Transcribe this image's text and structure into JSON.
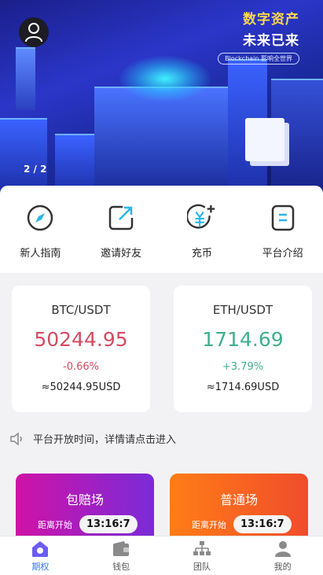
{
  "colors": {
    "accent": "#2d77ff",
    "down": "#d64a63",
    "up": "#3fae8d"
  },
  "banner": {
    "title_line1": "数字资产",
    "title_line2": "未来已来",
    "tagline": "Blockchain 影响全世界",
    "pager": "2 / 2"
  },
  "shortcuts": [
    {
      "label": "新人指南",
      "icon": "compass-icon"
    },
    {
      "label": "邀请好友",
      "icon": "share-icon"
    },
    {
      "label": "充币",
      "icon": "yen-plus-icon"
    },
    {
      "label": "平台介绍",
      "icon": "document-icon"
    }
  ],
  "markets": [
    {
      "pair": "BTC/USDT",
      "price": "50244.95",
      "change": "-0.66%",
      "usd": "≈50244.95USD",
      "trend": "down"
    },
    {
      "pair": "ETH/USDT",
      "price": "1714.69",
      "change": "+3.79%",
      "usd": "≈1714.69USD",
      "trend": "up"
    }
  ],
  "notice": {
    "text": "平台开放时间，详情请点击进入",
    "icon": "speaker-icon"
  },
  "arenas": [
    {
      "name": "包赔场",
      "countdown_label": "距离开始",
      "time": "13:16:7"
    },
    {
      "name": "普通场",
      "countdown_label": "距离开始",
      "time": "13:16:7"
    }
  ],
  "nav": [
    {
      "label": "期权",
      "icon": "home-icon",
      "active": true
    },
    {
      "label": "钱包",
      "icon": "wallet-icon",
      "active": false
    },
    {
      "label": "团队",
      "icon": "team-icon",
      "active": false
    },
    {
      "label": "我的",
      "icon": "user-icon",
      "active": false
    }
  ]
}
